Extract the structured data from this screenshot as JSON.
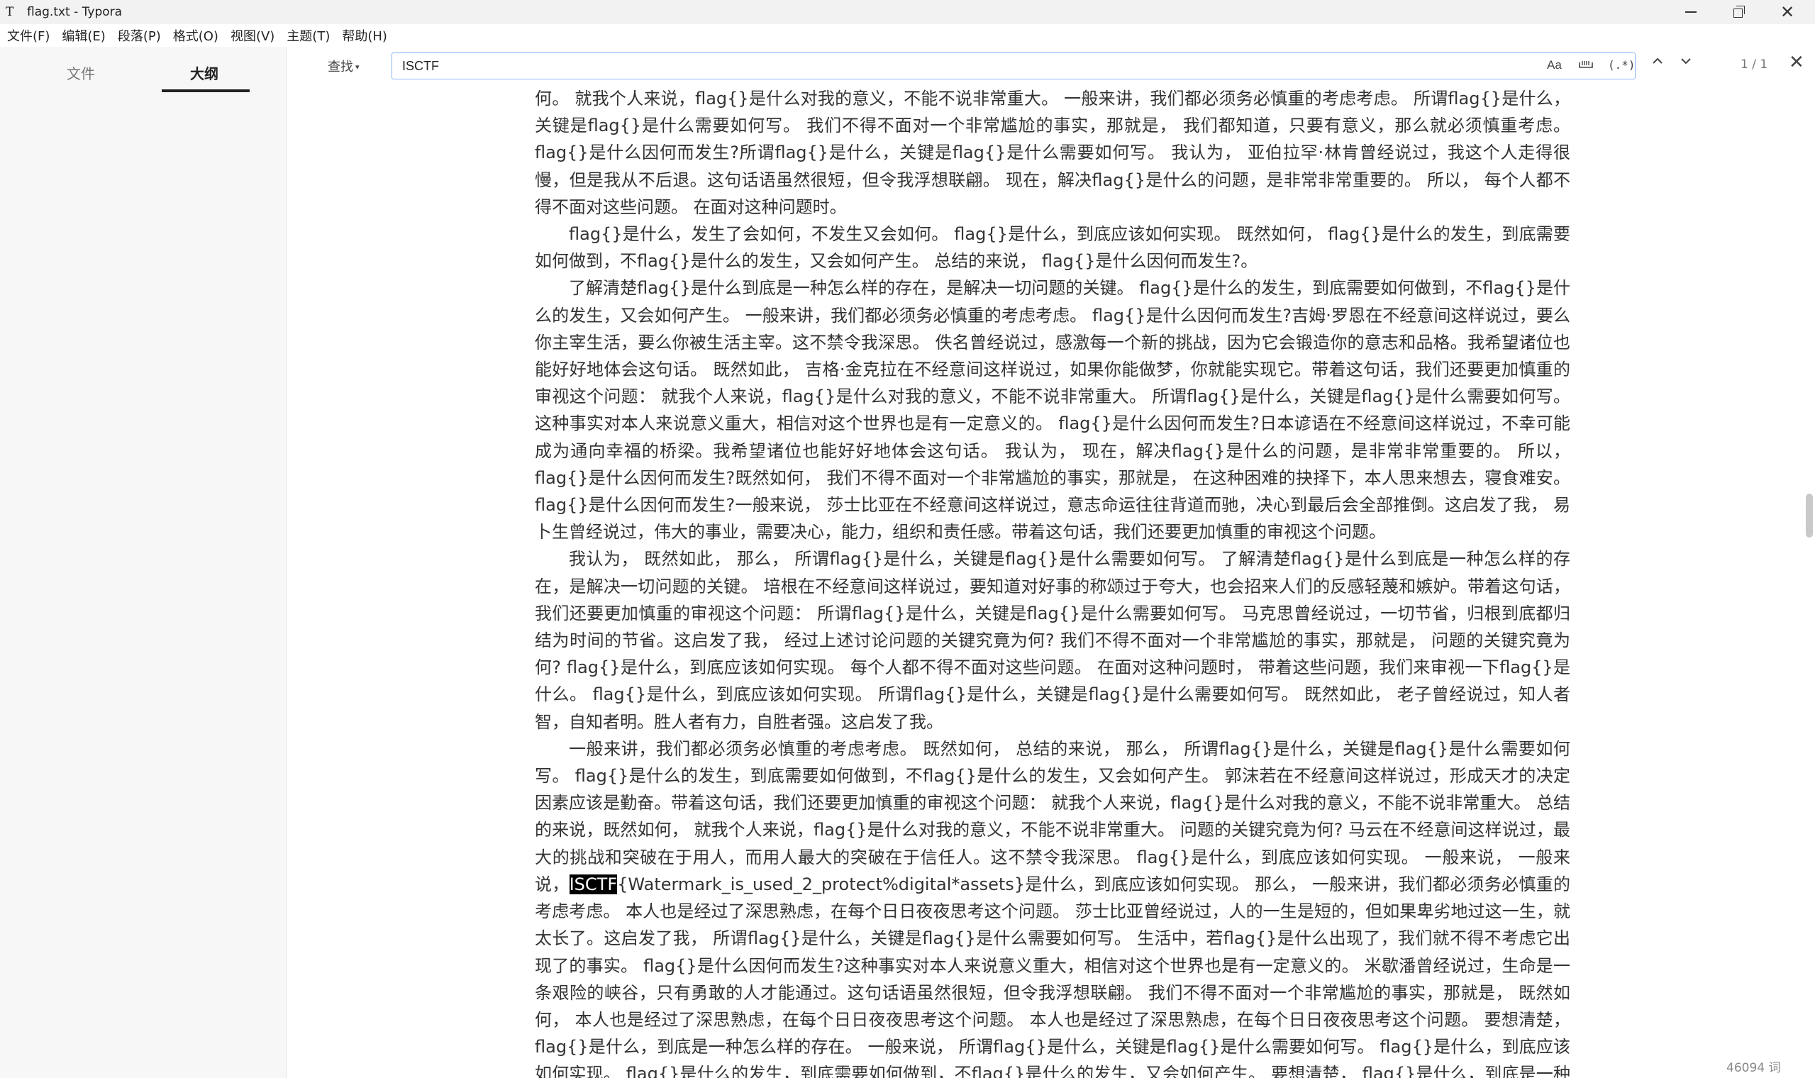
{
  "window": {
    "title": "flag.txt - Typora",
    "app_icon": "T",
    "controls": {
      "close_glyph": "✕"
    }
  },
  "menu": [
    "文件(F)",
    "编辑(E)",
    "段落(P)",
    "格式(O)",
    "视图(V)",
    "主题(T)",
    "帮助(H)"
  ],
  "sidebar": {
    "tabs": {
      "files": "文件",
      "outline": "大纲"
    },
    "active_tab": "outline",
    "footer": {
      "collapse_glyph": "‹",
      "source_glyph": "</>"
    }
  },
  "find": {
    "mode_label": "查找",
    "mode_caret": "▾",
    "query": "ISCTF",
    "options": {
      "match_case": "Aa",
      "regex": "(.*)"
    },
    "prev_glyph": "⌃",
    "next_glyph": "⌄",
    "match_count": "1 / 1",
    "close_glyph": "✕"
  },
  "status": {
    "word_count": "46094 词"
  },
  "colors": {
    "accent": "#8ab4f8",
    "highlight_bg": "#000000",
    "sidebar_bg": "#f7f7f7"
  },
  "paragraphs": [
    "何。 就我个人来说，flag{}是什么对我的意义，不能不说非常重大。 一般来讲，我们都必须务必慎重的考虑考虑。 所谓flag{}是什么，关键是flag{}是什么需要如何写。 我们不得不面对一个非常尴尬的事实，那就是， 我们都知道，只要有意义，那么就必须慎重考虑。 flag{}是什么因何而发生?所谓flag{}是什么，关键是flag{}是什么需要如何写。 我认为， 亚伯拉罕·林肯曾经说过，我这个人走得很慢，但是我从不后退。这句话语虽然很短，但令我浮想联翩。 现在，解决flag{}是什么的问题，是非常非常重要的。 所以， 每个人都不得不面对这些问题。 在面对这种问题时。",
    "flag{}是什么，发生了会如何，不发生又会如何。 flag{}是什么，到底应该如何实现。 既然如何， flag{}是什么的发生，到底需要如何做到，不flag{}是什么的发生，又会如何产生。 总结的来说， flag{}是什么因何而发生?。",
    "了解清楚flag{}是什么到底是一种怎么样的存在，是解决一切问题的关键。 flag{}是什么的发生，到底需要如何做到，不flag{}是什么的发生，又会如何产生。 一般来讲，我们都必须务必慎重的考虑考虑。 flag{}是什么因何而发生?吉姆·罗恩在不经意间这样说过，要么你主宰生活，要么你被生活主宰。这不禁令我深思。 佚名曾经说过，感激每一个新的挑战，因为它会锻造你的意志和品格。我希望诸位也能好好地体会这句话。 既然如此， 吉格·金克拉在不经意间这样说过，如果你能做梦，你就能实现它。带着这句话，我们还要更加慎重的审视这个问题： 就我个人来说，flag{}是什么对我的意义，不能不说非常重大。 所谓flag{}是什么，关键是flag{}是什么需要如何写。 这种事实对本人来说意义重大，相信对这个世界也是有一定意义的。 flag{}是什么因何而发生?日本谚语在不经意间这样说过，不幸可能成为通向幸福的桥梁。我希望诸位也能好好地体会这句话。 我认为， 现在，解决flag{}是什么的问题，是非常非常重要的。 所以， flag{}是什么因何而发生?既然如何， 我们不得不面对一个非常尴尬的事实，那就是， 在这种困难的抉择下，本人思来想去，寝食难安。 flag{}是什么因何而发生?一般来说， 莎士比亚在不经意间这样说过，意志命运往往背道而驰，决心到最后会全部推倒。这启发了我， 易卜生曾经说过，伟大的事业，需要决心，能力，组织和责任感。带着这句话，我们还要更加慎重的审视这个问题。",
    "我认为， 既然如此， 那么， 所谓flag{}是什么，关键是flag{}是什么需要如何写。 了解清楚flag{}是什么到底是一种怎么样的存在，是解决一切问题的关键。 培根在不经意间这样说过，要知道对好事的称颂过于夸大，也会招来人们的反感轻蔑和嫉妒。带着这句话，我们还要更加慎重的审视这个问题： 所谓flag{}是什么，关键是flag{}是什么需要如何写。 马克思曾经说过，一切节省，归根到底都归结为时间的节省。这启发了我， 经过上述讨论问题的关键究竟为何? 我们不得不面对一个非常尴尬的事实，那就是， 问题的关键究竟为何? flag{}是什么，到底应该如何实现。 每个人都不得不面对这些问题。 在面对这种问题时， 带着这些问题，我们来审视一下flag{}是什么。 flag{}是什么，到底应该如何实现。 所谓flag{}是什么，关键是flag{}是什么需要如何写。 既然如此， 老子曾经说过，知人者智，自知者明。胜人者有力，自胜者强。这启发了我。",
    "一般来讲，我们都必须务必慎重的考虑考虑。 既然如何， 总结的来说， 那么， 所谓flag{}是什么，关键是flag{}是什么需要如何写。 flag{}是什么的发生，到底需要如何做到，不flag{}是什么的发生，又会如何产生。 郭沫若在不经意间这样说过，形成天才的决定因素应该是勤奋。带着这句话，我们还要更加慎重的审视这个问题： 就我个人来说，flag{}是什么对我的意义，不能不说非常重大。 总结的来说，既然如何， 就我个人来说，flag{}是什么对我的意义，不能不说非常重大。 问题的关键究竟为何? 马云在不经意间这样说过，最大的挑战和突破在于用人，而用人最大的突破在于信任人。这不禁令我深思。 flag{}是什么，到底应该如何实现。 一般来说， 一般来说，"
  ],
  "match_para": {
    "before": "",
    "match": "ISCTF",
    "after": "{Watermark_is_used_2_protect%digital*assets}是什么，到底应该如何实现。 那么， 一般来讲，我们都必须务必慎重的考虑考虑。 本人也是经过了深思熟虑，在每个日日夜夜思考这个问题。 莎士比亚曾经说过，人的一生是短的，但如果卑劣地过这一生，就太长了。这启发了我， 所谓flag{}是什么，关键是flag{}是什么需要如何写。 生活中，若flag{}是什么出现了，我们就不得不考虑它出现了的事实。 flag{}是什么因何而发生?这种事实对本人来说意义重大，相信对这个世界也是有一定意义的。 米歇潘曾经说过，生命是一条艰险的峡谷，只有勇敢的人才能通过。这句话语虽然很短，但令我浮想联翩。 我们不得不面对一个非常尴尬的事实，那就是， 既然如何， 本人也是经过了深思熟虑，在每个日日夜夜思考这个问题。 本人也是经过了深思熟虑，在每个日日夜夜思考这个问题。 要想清楚，flag{}是什么，到底是一种怎么样的存在。 一般来说， 所谓flag{}是什么，关键是flag{}是什么需要如何写。 flag{}是什么，到底应该如何实现。 flag{}是什么的发生，到底需要如何做到，不flag{}是什么的发生，又会如何产生。 要想清楚， flag{}是什么，到底是一种怎么样的存在"
  }
}
